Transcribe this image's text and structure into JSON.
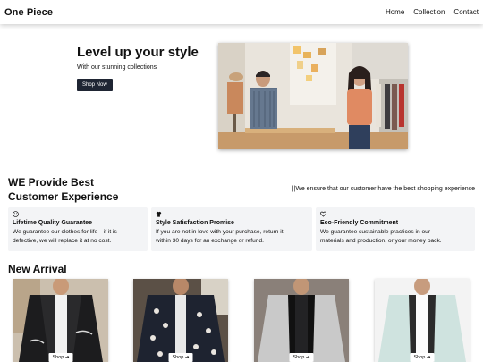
{
  "nav": {
    "brand": "One Piece",
    "links": [
      "Home",
      "Collection",
      "Contact"
    ]
  },
  "hero": {
    "title": "Level up your style",
    "subtitle": "With our stunning collections",
    "button": "Shop Now"
  },
  "features": {
    "heading_line1": "WE Provide Best",
    "heading_line2": "Customer Experience",
    "tagline": "||We ensure that our customer have the best shopping experience",
    "items": [
      {
        "icon": "smile-icon",
        "title": "Lifetime Quality Guarantee",
        "line1": "We guarantee our clothes for life—if it is",
        "line2": "defective, we will replace it at no cost."
      },
      {
        "icon": "shirt-icon",
        "title": "Style Satisfaction Promise",
        "line1": "If you are not in love with your purchase, return it",
        "line2": "within 30 days for an exchange or refund."
      },
      {
        "icon": "heart-icon",
        "title": "Eco-Friendly Commitment",
        "line1": "We guarantee sustainable practices in our",
        "line2": "materials and production, or your money back."
      }
    ]
  },
  "arrivals": {
    "title": "New Arrival",
    "shop_label": "Shop ➔"
  },
  "colors": {
    "button_dark": "#1f2533",
    "card_bg": "#f3f4f6"
  }
}
